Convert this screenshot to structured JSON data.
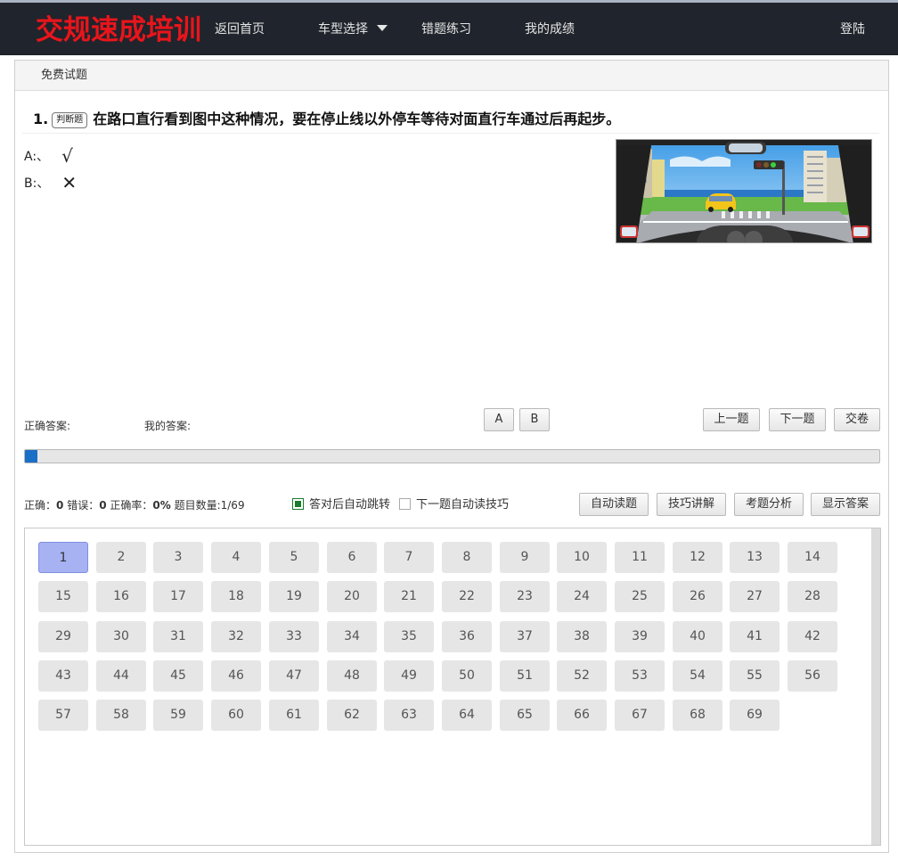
{
  "header": {
    "logo": "交规速成培训",
    "nav": [
      {
        "label": "返回首页"
      },
      {
        "label": "车型选择"
      },
      {
        "label": "错题练习"
      },
      {
        "label": "我的成绩"
      }
    ],
    "login": "登陆"
  },
  "panel": {
    "tab": "免费试题"
  },
  "question": {
    "number": "1.",
    "type": "判断题",
    "text": "在路口直行看到图中这种情况，要在停止线以外停车等待对面直行车通过后再起步。",
    "options": [
      {
        "label": "A:、",
        "mark": "√"
      },
      {
        "label": "B:、",
        "mark": "✕"
      }
    ]
  },
  "answer": {
    "correct_label": "正确答案:",
    "mine_label": "我的答案:",
    "choice_buttons": [
      "A",
      "B"
    ],
    "prev": "上一题",
    "next": "下一题",
    "submit": "交卷"
  },
  "progress": {
    "fraction": 0.0145
  },
  "stats": {
    "correct_label": "正确：",
    "correct": "0",
    "wrong_label": " 错误：",
    "wrong": "0",
    "rate_label": " 正确率：",
    "rate": "0%",
    "count_label": " 题目数量:",
    "count": "1/69"
  },
  "options": {
    "auto_jump": "答对后自动跳转",
    "auto_jump_checked": true,
    "auto_read": "下一题自动读技巧",
    "auto_read_checked": false
  },
  "tools": [
    "自动读题",
    "技巧讲解",
    "考题分析",
    "显示答案"
  ],
  "question_grid": {
    "total": 69,
    "current": 1
  },
  "colors": {
    "logo": "#e8151b",
    "topbar": "#20242c",
    "current_qn": "#a6b2f2",
    "progress": "#1a6fc6",
    "checkbox": "#1b7a2c"
  }
}
